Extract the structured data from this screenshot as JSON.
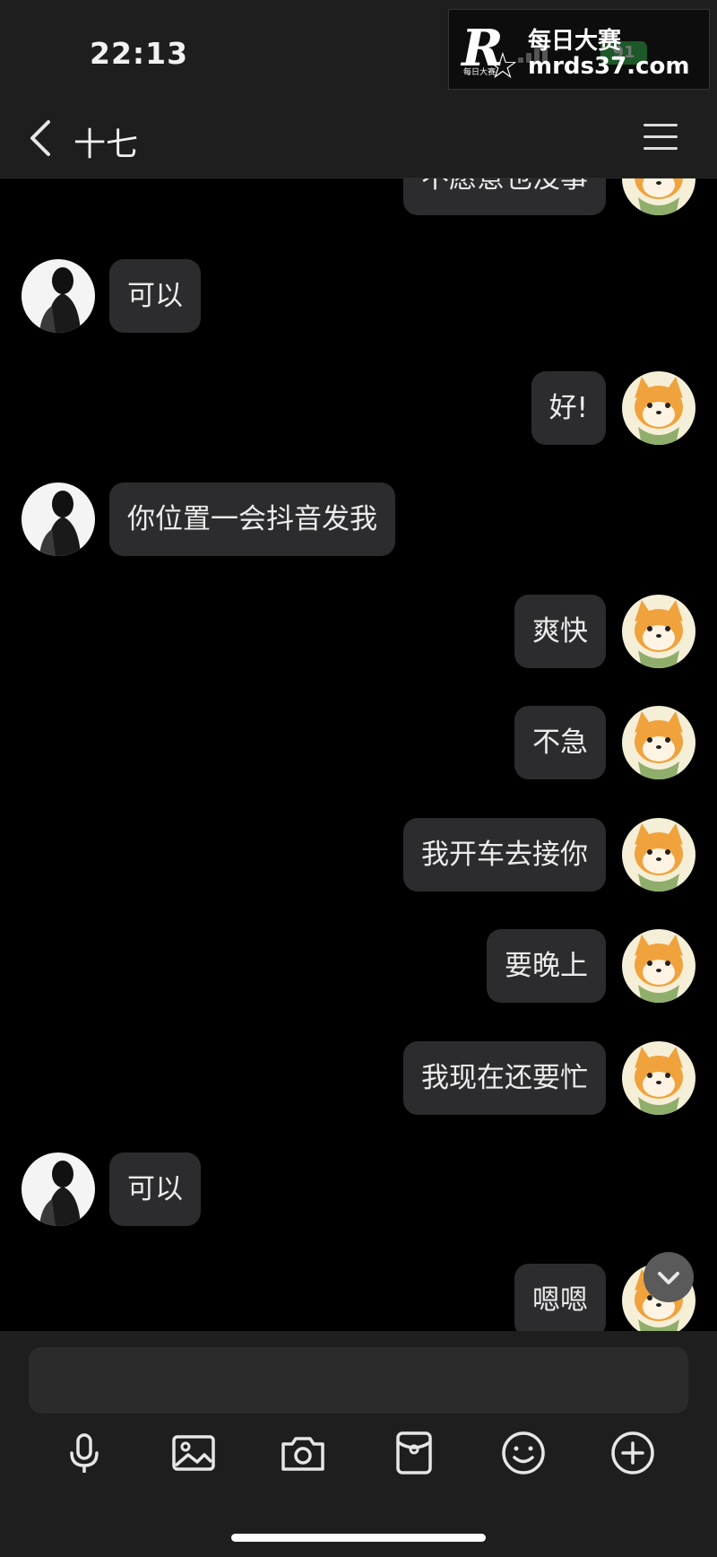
{
  "status_bar": {
    "time": "22:13",
    "battery": "91"
  },
  "watermark": {
    "logo_letter": "R",
    "small_text": "每日大赛",
    "brand_cn": "每日大赛",
    "url": "mrds37.com"
  },
  "nav": {
    "title": "十七",
    "back_icon": "chevron-left-icon",
    "menu_icon": "hamburger-menu-icon"
  },
  "messages": [
    {
      "side": "right",
      "text": "不愿意也没事"
    },
    {
      "side": "left",
      "text": "可以"
    },
    {
      "side": "right",
      "text": "好!"
    },
    {
      "side": "left",
      "text": "你位置一会抖音发我"
    },
    {
      "side": "right",
      "text": "爽快"
    },
    {
      "side": "right",
      "text": "不急"
    },
    {
      "side": "right",
      "text": "我开车去接你"
    },
    {
      "side": "right",
      "text": "要晚上"
    },
    {
      "side": "right",
      "text": "我现在还要忙"
    },
    {
      "side": "left",
      "text": "可以"
    },
    {
      "side": "right",
      "text": "嗯嗯"
    }
  ],
  "composer": {
    "placeholder": ""
  },
  "toolbar": [
    "microphone-icon",
    "image-icon",
    "camera-icon",
    "red-packet-icon",
    "emoji-icon",
    "plus-icon"
  ],
  "colors": {
    "background": "#000000",
    "bar": "#1e1e1e",
    "bubble": "#2c2c2e",
    "battery": "#3ec45a"
  }
}
